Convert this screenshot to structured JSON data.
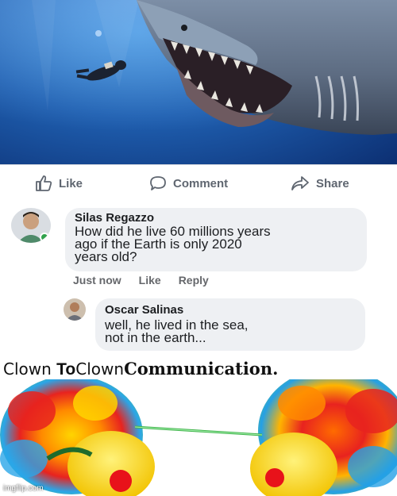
{
  "post_actions": {
    "like_label": "Like",
    "comment_label": "Comment",
    "share_label": "Share"
  },
  "comments": [
    {
      "author": "Silas Regazzo",
      "text": "How did he live 60 millions years\nago if the Earth is only 2020\nyears old?",
      "time": "Just now",
      "like": "Like",
      "reply": "Reply"
    },
    {
      "author": "Oscar Salinas",
      "text": "well, he lived in the sea,\nnot in the earth..."
    }
  ],
  "meme": {
    "caption_parts": [
      "Clown ",
      "To",
      "Clown",
      "Communication."
    ],
    "watermark": "imgflip.com"
  },
  "icons": [
    "thumbs-up-icon",
    "comment-icon",
    "share-arrow-icon"
  ]
}
